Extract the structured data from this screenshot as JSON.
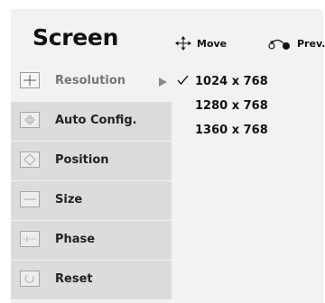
{
  "title": "Screen",
  "hints": {
    "move": {
      "label": "Move",
      "icon": "four-way-arrow-icon"
    },
    "prev": {
      "label": "Prev.",
      "icon": "return-arrow-icon"
    }
  },
  "menu": {
    "items": [
      {
        "label": "Resolution",
        "icon": "resolution-icon",
        "selected": true
      },
      {
        "label": "Auto Config.",
        "icon": "auto-config-icon",
        "selected": false
      },
      {
        "label": "Position",
        "icon": "position-icon",
        "selected": false
      },
      {
        "label": "Size",
        "icon": "size-icon",
        "selected": false
      },
      {
        "label": "Phase",
        "icon": "phase-icon",
        "selected": false
      },
      {
        "label": "Reset",
        "icon": "reset-icon",
        "selected": false
      }
    ]
  },
  "resolution_options": {
    "items": [
      {
        "label": "1024 x 768",
        "checked": true
      },
      {
        "label": "1280 x 768",
        "checked": false
      },
      {
        "label": "1360 x 768",
        "checked": false
      }
    ]
  },
  "colors": {
    "panel_background": "#f2f2f2",
    "menu_item_background": "#dcdcdc",
    "active_label": "#777777",
    "text": "#111111"
  }
}
